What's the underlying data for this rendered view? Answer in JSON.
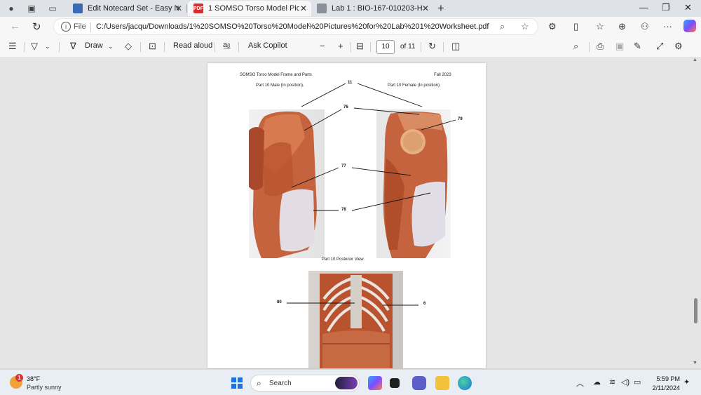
{
  "browser": {
    "tabs": [
      {
        "label": "Edit Notecard Set - Easy Notecar",
        "favicon_color": "#3b6bb5"
      },
      {
        "label": "1 SOMSO Torso Model Pictures f",
        "favicon_color": "#d32f2f",
        "favicon_text": "PDF"
      },
      {
        "label": "Lab 1 : BIO-167-010203-Human",
        "favicon_color": "#8a8f99"
      }
    ],
    "address": {
      "scheme_label": "File",
      "url": "C:/Users/jacqu/Downloads/1%20SOMSO%20Torso%20Model%20Pictures%20for%20Lab%201%20Worksheet.pdf"
    }
  },
  "pdf_toolbar": {
    "draw": "Draw",
    "read_aloud": "Read aloud",
    "ask_copilot": "Ask Copilot",
    "page_current": "10",
    "page_total": "of 11"
  },
  "page": {
    "header_left": "SOMSO Torso Model Frame and Parts",
    "header_right": "Fall 2023",
    "caption_male": "Part 10 Male (In position).",
    "caption_female": "Part 10 Female (In position).",
    "caption_posterior": "Part 10 Posterior View.",
    "labels": {
      "l11": "11",
      "l76": "76",
      "l79": "79",
      "l77": "77",
      "l78": "78",
      "l80": "80",
      "l6": "6"
    }
  },
  "taskbar": {
    "weather_temp": "38°F",
    "weather_desc": "Partly sunny",
    "weather_badge": "1",
    "search": "Search",
    "time": "5:59 PM",
    "date": "2/11/2024"
  }
}
